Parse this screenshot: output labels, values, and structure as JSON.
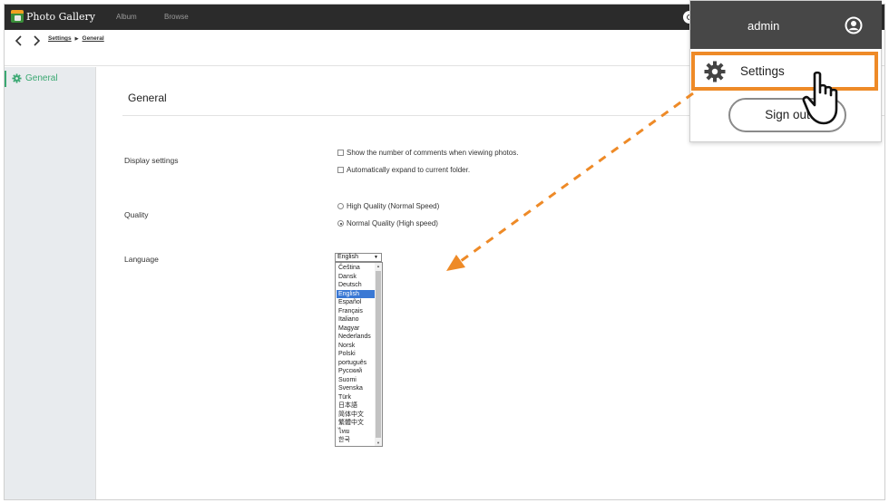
{
  "app": {
    "name": "Photo Gallery"
  },
  "topnav": {
    "album": "Album",
    "browse": "Browse"
  },
  "breadcrumb": {
    "items": [
      "Settings",
      "General"
    ],
    "separator": "▶"
  },
  "sidebar": {
    "items": [
      {
        "label": "General",
        "icon": "gear-icon",
        "active": true
      }
    ]
  },
  "main": {
    "title": "General",
    "display": {
      "label": "Display settings",
      "options": [
        {
          "label": "Show the number of comments when viewing photos.",
          "checked": false
        },
        {
          "label": "Automatically expand to current folder.",
          "checked": false
        }
      ]
    },
    "quality": {
      "label": "Quality",
      "options": [
        {
          "label": "High Quality (Normal Speed)",
          "selected": false
        },
        {
          "label": "Normal Quality (High speed)",
          "selected": true
        }
      ]
    },
    "language": {
      "label": "Language",
      "selected": "English",
      "options": [
        "Čeština",
        "Dansk",
        "Deutsch",
        "English",
        "Español",
        "Français",
        "Italiano",
        "Magyar",
        "Nederlands",
        "Norsk",
        "Polski",
        "português",
        "Русский",
        "Suomi",
        "Svenska",
        "Türk",
        "日本語",
        "简体中文",
        "繁體中文",
        "ไทย",
        "한국"
      ]
    }
  },
  "user_menu": {
    "username": "admin",
    "settings": "Settings",
    "sign_out": "Sign out"
  },
  "colors": {
    "accent_green": "#3aa872",
    "highlight_orange": "#ee8a27",
    "topbar": "#2b2b2b",
    "selection_blue": "#3a78d4"
  }
}
